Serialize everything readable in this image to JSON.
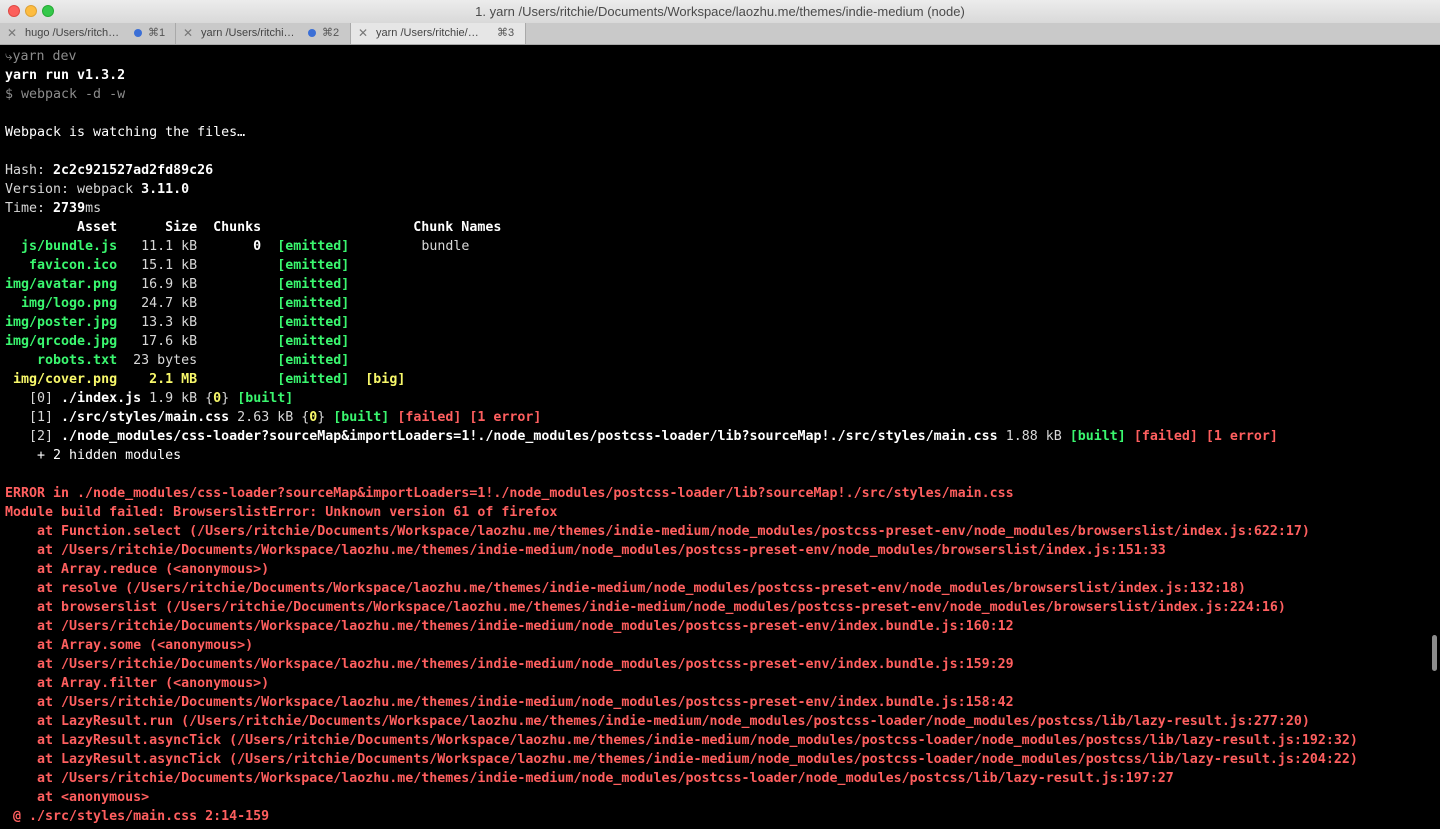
{
  "window": {
    "title": "1. yarn  /Users/ritchie/Documents/Workspace/laozhu.me/themes/indie-medium (node)"
  },
  "tabs": [
    {
      "label": "hugo  /Users/ritch…",
      "shortcut": "⌘1"
    },
    {
      "label": "yarn  /Users/ritchi…",
      "shortcut": "⌘2"
    },
    {
      "label": "yarn  /Users/ritchie/…",
      "shortcut": "⌘3"
    }
  ],
  "colors": {
    "green": "#3af76f",
    "yellow": "#f8f86a",
    "red": "#ff5f5f",
    "tab_dot": "#3b6fd6"
  },
  "terminal": {
    "lines": [
      {
        "segs": [
          {
            "t": "⤷",
            "c": "dim"
          },
          {
            "t": "yarn dev",
            "c": "dim"
          }
        ]
      },
      {
        "segs": [
          {
            "t": "yarn run v1.3.2",
            "c": "w b"
          }
        ]
      },
      {
        "segs": [
          {
            "t": "$ webpack -d -w",
            "c": "dim"
          }
        ]
      },
      {
        "segs": []
      },
      {
        "segs": [
          {
            "t": "Webpack is watching the files…",
            "c": "w"
          }
        ]
      },
      {
        "segs": []
      },
      {
        "segs": [
          {
            "t": "Hash: ",
            "c": ""
          },
          {
            "t": "2c2c921527ad2fd89c26",
            "c": "w b"
          }
        ]
      },
      {
        "segs": [
          {
            "t": "Version: webpack ",
            "c": ""
          },
          {
            "t": "3.11.0",
            "c": "w b"
          }
        ]
      },
      {
        "segs": [
          {
            "t": "Time: ",
            "c": ""
          },
          {
            "t": "2739",
            "c": "w b"
          },
          {
            "t": "ms",
            "c": ""
          }
        ]
      },
      {
        "segs": [
          {
            "t": "         Asset      Size  Chunks                   Chunk Names",
            "c": "w b"
          }
        ]
      },
      {
        "segs": [
          {
            "t": "  js/bundle.js",
            "c": "g b"
          },
          {
            "t": "   11.1 kB       ",
            "c": ""
          },
          {
            "t": "0",
            "c": "w b"
          },
          {
            "t": "  ",
            "c": ""
          },
          {
            "t": "[emitted]",
            "c": "g b"
          },
          {
            "t": "         bundle",
            "c": ""
          }
        ]
      },
      {
        "segs": [
          {
            "t": "   favicon.ico",
            "c": "g b"
          },
          {
            "t": "   15.1 kB          ",
            "c": ""
          },
          {
            "t": "[emitted]",
            "c": "g b"
          }
        ]
      },
      {
        "segs": [
          {
            "t": "img/avatar.png",
            "c": "g b"
          },
          {
            "t": "   16.9 kB          ",
            "c": ""
          },
          {
            "t": "[emitted]",
            "c": "g b"
          }
        ]
      },
      {
        "segs": [
          {
            "t": "  img/logo.png",
            "c": "g b"
          },
          {
            "t": "   24.7 kB          ",
            "c": ""
          },
          {
            "t": "[emitted]",
            "c": "g b"
          }
        ]
      },
      {
        "segs": [
          {
            "t": "img/poster.jpg",
            "c": "g b"
          },
          {
            "t": "   13.3 kB          ",
            "c": ""
          },
          {
            "t": "[emitted]",
            "c": "g b"
          }
        ]
      },
      {
        "segs": [
          {
            "t": "img/qrcode.jpg",
            "c": "g b"
          },
          {
            "t": "   17.6 kB          ",
            "c": ""
          },
          {
            "t": "[emitted]",
            "c": "g b"
          }
        ]
      },
      {
        "segs": [
          {
            "t": "    robots.txt",
            "c": "g b"
          },
          {
            "t": "  23 bytes          ",
            "c": ""
          },
          {
            "t": "[emitted]",
            "c": "g b"
          }
        ]
      },
      {
        "segs": [
          {
            "t": " img/cover.png",
            "c": "y b"
          },
          {
            "t": "    ",
            "c": ""
          },
          {
            "t": "2.1 MB",
            "c": "y b"
          },
          {
            "t": "          ",
            "c": ""
          },
          {
            "t": "[emitted]",
            "c": "g b"
          },
          {
            "t": "  ",
            "c": ""
          },
          {
            "t": "[big]",
            "c": "y b"
          }
        ]
      },
      {
        "segs": [
          {
            "t": "   [0] ",
            "c": ""
          },
          {
            "t": "./index.js",
            "c": "w b"
          },
          {
            "t": " 1.9 kB {",
            "c": ""
          },
          {
            "t": "0",
            "c": "y b"
          },
          {
            "t": "} ",
            "c": ""
          },
          {
            "t": "[built]",
            "c": "g b"
          }
        ]
      },
      {
        "segs": [
          {
            "t": "   [1] ",
            "c": ""
          },
          {
            "t": "./src/styles/main.css",
            "c": "w b"
          },
          {
            "t": " 2.63 kB {",
            "c": ""
          },
          {
            "t": "0",
            "c": "y b"
          },
          {
            "t": "} ",
            "c": ""
          },
          {
            "t": "[built]",
            "c": "g b"
          },
          {
            "t": " ",
            "c": ""
          },
          {
            "t": "[failed]",
            "c": "r b"
          },
          {
            "t": " ",
            "c": ""
          },
          {
            "t": "[1 error]",
            "c": "r b"
          }
        ]
      },
      {
        "segs": [
          {
            "t": "   [2] ",
            "c": ""
          },
          {
            "t": "./node_modules/css-loader?sourceMap&importLoaders=1!./node_modules/postcss-loader/lib?sourceMap!./src/styles/main.css",
            "c": "w b"
          },
          {
            "t": " 1.88 kB ",
            "c": ""
          },
          {
            "t": "[built]",
            "c": "g b"
          },
          {
            "t": " ",
            "c": ""
          },
          {
            "t": "[failed]",
            "c": "r b"
          },
          {
            "t": " ",
            "c": ""
          },
          {
            "t": "[1 error]",
            "c": "r b"
          }
        ]
      },
      {
        "segs": [
          {
            "t": "    + 2 hidden modules",
            "c": "w"
          }
        ]
      },
      {
        "segs": []
      },
      {
        "segs": [
          {
            "t": "ERROR in ./node_modules/css-loader?sourceMap&importLoaders=1!./node_modules/postcss-loader/lib?sourceMap!./src/styles/main.css",
            "c": "r b"
          }
        ]
      },
      {
        "segs": [
          {
            "t": "Module build failed: BrowserslistError: Unknown version 61 of firefox",
            "c": "r b"
          }
        ]
      },
      {
        "segs": [
          {
            "t": "    at Function.select (/Users/ritchie/Documents/Workspace/laozhu.me/themes/indie-medium/node_modules/postcss-preset-env/node_modules/browserslist/index.js:622:17)",
            "c": "r b"
          }
        ]
      },
      {
        "segs": [
          {
            "t": "    at /Users/ritchie/Documents/Workspace/laozhu.me/themes/indie-medium/node_modules/postcss-preset-env/node_modules/browserslist/index.js:151:33",
            "c": "r b"
          }
        ]
      },
      {
        "segs": [
          {
            "t": "    at Array.reduce (<anonymous>)",
            "c": "r b"
          }
        ]
      },
      {
        "segs": [
          {
            "t": "    at resolve (/Users/ritchie/Documents/Workspace/laozhu.me/themes/indie-medium/node_modules/postcss-preset-env/node_modules/browserslist/index.js:132:18)",
            "c": "r b"
          }
        ]
      },
      {
        "segs": [
          {
            "t": "    at browserslist (/Users/ritchie/Documents/Workspace/laozhu.me/themes/indie-medium/node_modules/postcss-preset-env/node_modules/browserslist/index.js:224:16)",
            "c": "r b"
          }
        ]
      },
      {
        "segs": [
          {
            "t": "    at /Users/ritchie/Documents/Workspace/laozhu.me/themes/indie-medium/node_modules/postcss-preset-env/index.bundle.js:160:12",
            "c": "r b"
          }
        ]
      },
      {
        "segs": [
          {
            "t": "    at Array.some (<anonymous>)",
            "c": "r b"
          }
        ]
      },
      {
        "segs": [
          {
            "t": "    at /Users/ritchie/Documents/Workspace/laozhu.me/themes/indie-medium/node_modules/postcss-preset-env/index.bundle.js:159:29",
            "c": "r b"
          }
        ]
      },
      {
        "segs": [
          {
            "t": "    at Array.filter (<anonymous>)",
            "c": "r b"
          }
        ]
      },
      {
        "segs": [
          {
            "t": "    at /Users/ritchie/Documents/Workspace/laozhu.me/themes/indie-medium/node_modules/postcss-preset-env/index.bundle.js:158:42",
            "c": "r b"
          }
        ]
      },
      {
        "segs": [
          {
            "t": "    at LazyResult.run (/Users/ritchie/Documents/Workspace/laozhu.me/themes/indie-medium/node_modules/postcss-loader/node_modules/postcss/lib/lazy-result.js:277:20)",
            "c": "r b"
          }
        ]
      },
      {
        "segs": [
          {
            "t": "    at LazyResult.asyncTick (/Users/ritchie/Documents/Workspace/laozhu.me/themes/indie-medium/node_modules/postcss-loader/node_modules/postcss/lib/lazy-result.js:192:32)",
            "c": "r b"
          }
        ]
      },
      {
        "segs": [
          {
            "t": "    at LazyResult.asyncTick (/Users/ritchie/Documents/Workspace/laozhu.me/themes/indie-medium/node_modules/postcss-loader/node_modules/postcss/lib/lazy-result.js:204:22)",
            "c": "r b"
          }
        ]
      },
      {
        "segs": [
          {
            "t": "    at /Users/ritchie/Documents/Workspace/laozhu.me/themes/indie-medium/node_modules/postcss-loader/node_modules/postcss/lib/lazy-result.js:197:27",
            "c": "r b"
          }
        ]
      },
      {
        "segs": [
          {
            "t": "    at <anonymous>",
            "c": "r b"
          }
        ]
      },
      {
        "segs": [
          {
            "t": " @ ./src/styles/main.css 2:14-159",
            "c": "r b"
          }
        ]
      }
    ]
  }
}
